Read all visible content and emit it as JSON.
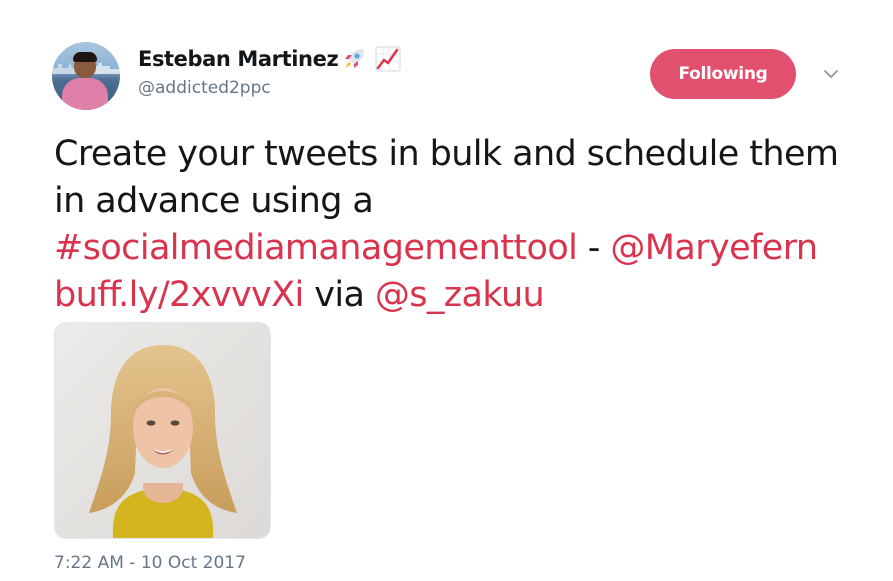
{
  "author": {
    "display_name": "Esteban Martinez",
    "emoji_1": "rocket-icon",
    "emoji_2": "chart-increasing-icon",
    "handle": "@addicted2ppc"
  },
  "follow_button": {
    "label": "Following",
    "color": "#e2506f"
  },
  "tweet": {
    "text_1": "Create your tweets in bulk and schedule them in advance using a ",
    "hashtag": "#socialmediamanagementtool",
    "text_2": " - ",
    "mention_1": "@Maryefern",
    "text_3": " ",
    "url": "buff.ly/2xvvvXi",
    "text_4": " via ",
    "mention_2": "@s_zakuu",
    "link_color": "#d9334e"
  },
  "timestamp": "7:22 AM - 10 Oct 2017"
}
